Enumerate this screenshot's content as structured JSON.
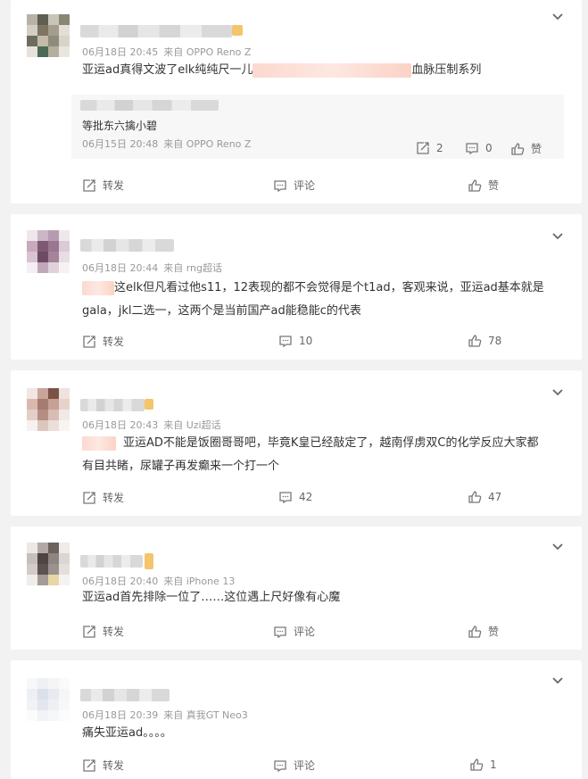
{
  "comments": [
    {
      "time": "06月18日 20:45",
      "source": "来自 OPPO Reno Z",
      "text_parts": [
        "亚运ad真得文波了elk纯纯尺一儿",
        "血脉压制系列"
      ],
      "reply": {
        "text": "等批东六擒小碧",
        "time": "06月15日 20:48",
        "source": "来自 OPPO Reno Z",
        "repost_count": "2",
        "comment_count": "0",
        "like_label": "赞"
      },
      "repost_label": "转发",
      "comment_label": "评论",
      "like_label": "赞"
    },
    {
      "time": "06月18日 20:44",
      "source": "来自 rng超话",
      "text_parts": [
        "这elk但凡看过他s11，12表现的都不会觉得是个t1ad，客观来说，亚运ad基本就是",
        "gala，jkl二选一，这两个是当前国产ad能稳能c的代表"
      ],
      "repost_label": "转发",
      "comment_count": "10",
      "like_count": "78"
    },
    {
      "time": "06月18日 20:43",
      "source": "来自 Uzi超话",
      "text_parts": [
        "亚运AD不能是饭圈哥哥吧，毕竟K皇已经敲定了，越南俘虏双C的化学反应大家都",
        "有目共睹，尿罐子再发癫来一个打一个"
      ],
      "repost_label": "转发",
      "comment_count": "42",
      "like_count": "47"
    },
    {
      "time": "06月18日 20:40",
      "source": "来自 iPhone 13",
      "text": "亚运ad首先排除一位了……这位遇上尺好像有心魔",
      "repost_label": "转发",
      "comment_label": "评论",
      "like_label": "赞"
    },
    {
      "time": "06月18日 20:39",
      "source": "来自 真我GT Neo3",
      "text": "痛失亚运ad。。。。",
      "repost_label": "转发",
      "comment_label": "评论",
      "like_count": "1"
    }
  ]
}
